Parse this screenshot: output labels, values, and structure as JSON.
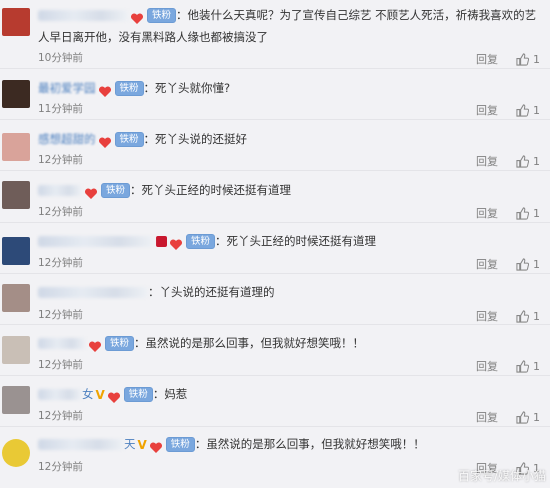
{
  "badge_label": "铁粉",
  "reply_label": "回复",
  "like_count": "1",
  "watermark": "百家号/媒体小猫",
  "comments": [
    {
      "username": "",
      "text": "他装什么天真呢？为了宣传自己综艺 不顾艺人死活，祈祷我喜欢的艺人早日离开他，没有黑料路人缘也都被搞没了",
      "time": "10分钟前",
      "avatar_color": "#b73b2f"
    },
    {
      "username": "最初爱学园",
      "text": "死丫头就你懂?",
      "time": "11分钟前",
      "avatar_color": "#3c2a22"
    },
    {
      "username": "感想超甜的",
      "text": "死丫头说的还挺好",
      "time": "12分钟前",
      "avatar_color": "#d9a39a"
    },
    {
      "username": "",
      "text": "死丫头正经的时候还挺有道理",
      "time": "12分钟前",
      "avatar_color": "#6f5d59"
    },
    {
      "username": "",
      "text": "死丫头正经的时候还挺有道理",
      "time": "12分钟前",
      "avatar_color": "#2d4a78"
    },
    {
      "username": "",
      "text": "丫头说的还挺有道理的",
      "time": "12分钟前",
      "avatar_color": "#a48e87"
    },
    {
      "username": "",
      "text": "虽然说的是那么回事，但我就好想笑哦！！",
      "time": "12分钟前",
      "avatar_color": "#c9bfb6"
    },
    {
      "username": "女",
      "text": "妈惹",
      "time": "12分钟前",
      "avatar_color": "#9a9291"
    },
    {
      "username": "天",
      "text": "虽然说的是那么回事，但我就好想笑哦！！",
      "time": "12分钟前",
      "avatar_color": "#e9c935"
    }
  ]
}
